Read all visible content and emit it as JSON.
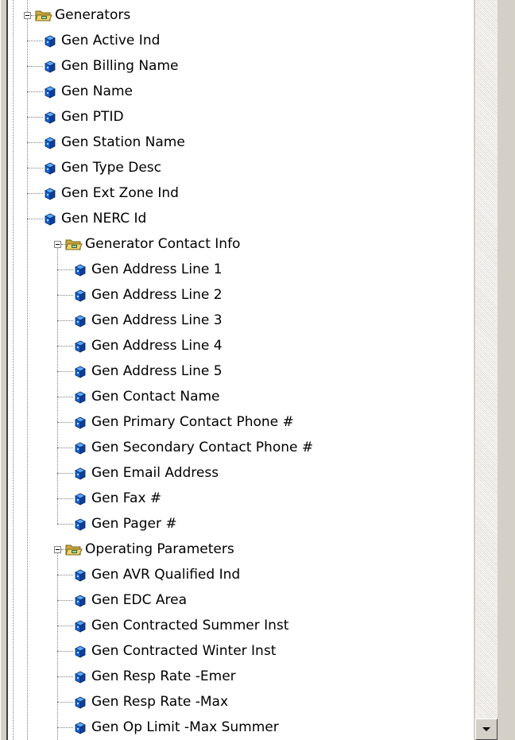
{
  "tree": {
    "generators": {
      "label": "Generators",
      "items": [
        "Gen Active Ind",
        "Gen Billing Name",
        "Gen Name",
        "Gen PTID",
        "Gen Station Name",
        "Gen Type Desc",
        "Gen Ext Zone Ind",
        "Gen NERC Id"
      ],
      "contact": {
        "label": "Generator Contact Info",
        "items": [
          "Gen Address Line 1",
          "Gen Address Line 2",
          "Gen Address Line 3",
          "Gen Address Line 4",
          "Gen Address Line 5",
          "Gen Contact Name",
          "Gen Primary Contact Phone #",
          "Gen Secondary Contact Phone #",
          "Gen Email Address",
          "Gen Fax #",
          "Gen Pager #"
        ]
      },
      "operating": {
        "label": "Operating Parameters",
        "items": [
          "Gen AVR Qualified Ind",
          "Gen EDC Area",
          "Gen Contracted Summer Inst",
          "Gen Contracted Winter Inst",
          "Gen Resp Rate -Emer",
          "Gen Resp Rate -Max",
          "Gen Op Limit -Max Summer"
        ]
      }
    },
    "icons": {
      "expander": "minus-box-icon",
      "folder": "open-folder-icon",
      "field": "blue-cube-icon"
    }
  },
  "colors": {
    "window_bg": "#ffffff",
    "chrome": "#d4d0c8",
    "cube_blue": "#1565d8",
    "folder_yellow": "#f2d36b"
  }
}
